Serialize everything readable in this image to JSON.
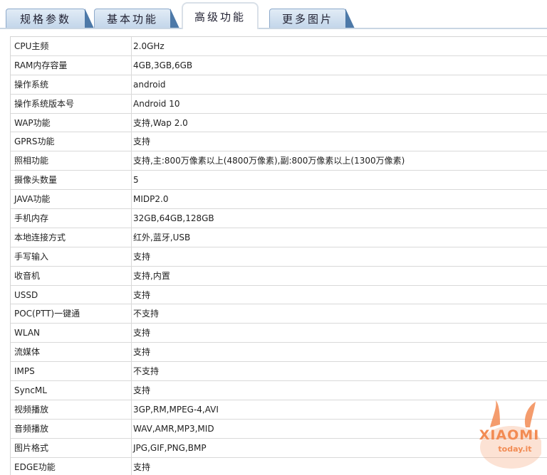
{
  "tabs": [
    {
      "label": "规格参数"
    },
    {
      "label": "基本功能"
    },
    {
      "label": "高级功能"
    },
    {
      "label": "更多图片"
    }
  ],
  "rows": [
    {
      "label": "CPU主频",
      "value": "2.0GHz"
    },
    {
      "label": "RAM内存容量",
      "value": "4GB,3GB,6GB"
    },
    {
      "label": "操作系统",
      "value": "android"
    },
    {
      "label": "操作系统版本号",
      "value": "Android 10"
    },
    {
      "label": "WAP功能",
      "value": "支持,Wap 2.0"
    },
    {
      "label": "GPRS功能",
      "value": "支持"
    },
    {
      "label": "照相功能",
      "value": "支持,主:800万像素以上(4800万像素),副:800万像素以上(1300万像素)"
    },
    {
      "label": "摄像头数量",
      "value": "5"
    },
    {
      "label": "JAVA功能",
      "value": "MIDP2.0"
    },
    {
      "label": "手机内存",
      "value": "32GB,64GB,128GB"
    },
    {
      "label": "本地连接方式",
      "value": "红外,蓝牙,USB"
    },
    {
      "label": "手写输入",
      "value": "支持"
    },
    {
      "label": "收音机",
      "value": "支持,内置"
    },
    {
      "label": "USSD",
      "value": "支持"
    },
    {
      "label": "POC(PTT)一键通",
      "value": "不支持"
    },
    {
      "label": "WLAN",
      "value": "支持"
    },
    {
      "label": "流媒体",
      "value": "支持"
    },
    {
      "label": "IMPS",
      "value": "不支持"
    },
    {
      "label": "SyncML",
      "value": "支持"
    },
    {
      "label": "视频播放",
      "value": "3GP,RM,MPEG-4,AVI"
    },
    {
      "label": "音频播放",
      "value": "WAV,AMR,MP3,MID"
    },
    {
      "label": "图片格式",
      "value": "JPG,GIF,PNG,BMP"
    },
    {
      "label": "EDGE功能",
      "value": "支持"
    }
  ],
  "watermark": {
    "brand": "XIAOMI",
    "site": "today.it",
    "color": "#f28b53"
  }
}
